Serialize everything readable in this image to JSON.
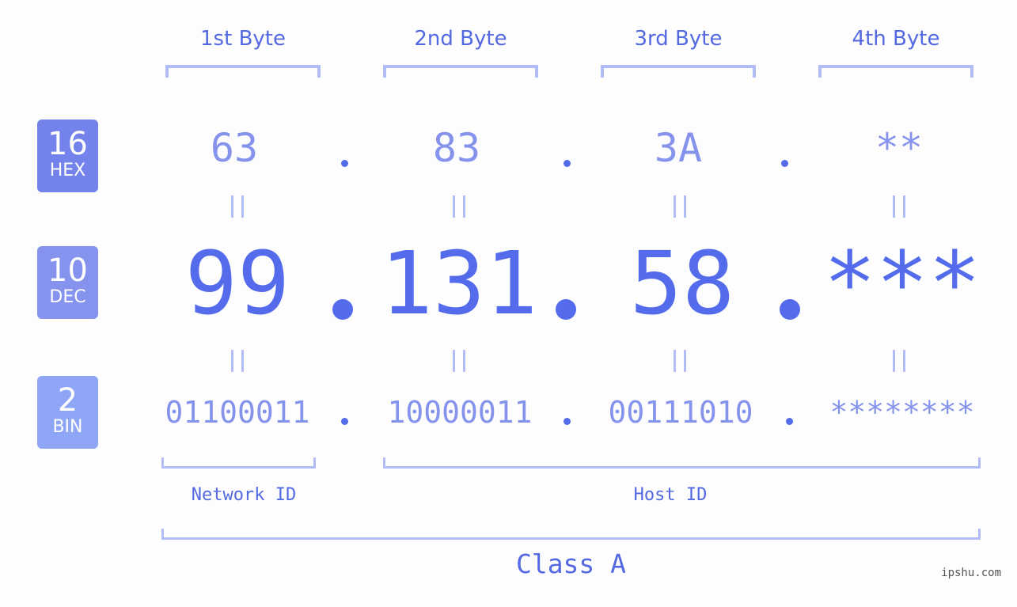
{
  "byte_headers": [
    "1st Byte",
    "2nd Byte",
    "3rd Byte",
    "4th Byte"
  ],
  "rows": {
    "hex": {
      "base": "16",
      "label": "HEX",
      "values": [
        "63",
        "83",
        "3A",
        "**"
      ]
    },
    "dec": {
      "base": "10",
      "label": "DEC",
      "values": [
        "99",
        "131",
        "58",
        "***"
      ]
    },
    "bin": {
      "base": "2",
      "label": "BIN",
      "values": [
        "01100011",
        "10000011",
        "00111010",
        "********"
      ]
    }
  },
  "separator": ".",
  "network_id_label": "Network ID",
  "host_id_label": "Host ID",
  "class_label": "Class A",
  "watermark": "ipshu.com",
  "colors": {
    "hex_badge": "#7483eb",
    "dec_badge": "#8593ef",
    "bin_badge": "#8fa6f7",
    "primary_text": "#546ceb",
    "light_text": "#8593ec",
    "bracket": "#b2bdf7",
    "background": "#fcfdfc"
  }
}
